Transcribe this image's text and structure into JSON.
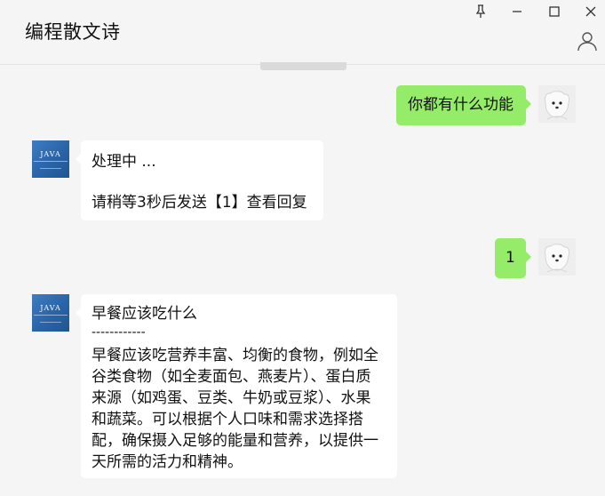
{
  "window": {
    "title": "编程散文诗",
    "controls": [
      "pin-icon",
      "minimize-icon",
      "maximize-icon",
      "close-icon"
    ],
    "profile_icon": "person-icon"
  },
  "colors": {
    "background": "#f5f5f5",
    "self_bubble": "#95ec69",
    "other_bubble": "#ffffff"
  },
  "messages": [
    {
      "sender": "self",
      "avatar": "dog-avatar",
      "lines": [
        "你都有什么功能"
      ]
    },
    {
      "sender": "bot",
      "avatar": "java-avatar",
      "avatar_text": "JAVA",
      "lines": [
        "处理中 ...",
        "",
        "请稍等3秒后发送【1】查看回复"
      ]
    },
    {
      "sender": "self",
      "avatar": "dog-avatar",
      "lines": [
        "1"
      ]
    },
    {
      "sender": "bot",
      "avatar": "java-avatar",
      "avatar_text": "JAVA",
      "lines": [
        "早餐应该吃什么",
        "------------",
        "早餐应该吃营养丰富、均衡的食物，例如全",
        "谷类食物（如全麦面包、燕麦片）、蛋白质",
        "来源（如鸡蛋、豆类、牛奶或豆浆）、水果",
        "和蔬菜。可以根据个人口味和需求选择搭",
        "配，确保摄入足够的能量和营养，以提供一",
        "天所需的活力和精神。"
      ]
    }
  ]
}
